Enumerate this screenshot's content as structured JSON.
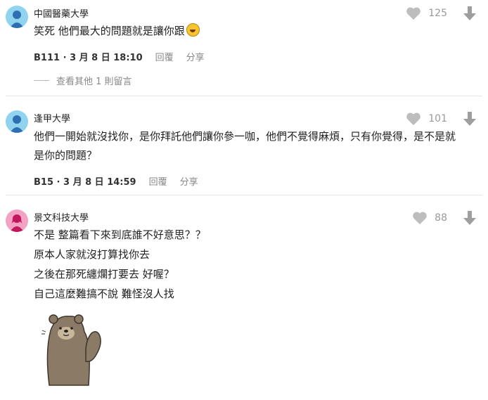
{
  "comments": [
    {
      "school": "中國醫藥大學",
      "lines": [
        "笑死 他們最大的問題就是讓你跟"
      ],
      "floor": "B111",
      "time": "3 月 8 日 18:10",
      "reply_label": "回覆",
      "share_label": "分享",
      "likes": "125",
      "more_replies": "查看其他 1 則留言",
      "avatar_color": "#8fd3ee"
    },
    {
      "school": "逢甲大學",
      "lines": [
        "他們一開始就沒找你，是你拜託他們讓你參一咖，他們不覺得麻煩，只有你覺得，是不是就",
        "是你的問題？"
      ],
      "floor": "B15",
      "time": "3 月 8 日 14:59",
      "reply_label": "回覆",
      "share_label": "分享",
      "likes": "101",
      "avatar_color": "#8fd3ee"
    },
    {
      "school": "景文科技大學",
      "lines": [
        "不是 整篇看下來到底誰不好意思？？",
        "原本人家就沒打算找你去",
        "之後在那死纏爛打要去 好喔？",
        "自己這麼難搞不說 難怪沒人找"
      ],
      "likes": "88",
      "avatar_color": "#f2a2c2",
      "sticker": "bear-sticker"
    }
  ],
  "meta_separator": "·",
  "icons": {
    "like": "heart-icon",
    "dislike": "arrow-down-icon",
    "emoji": "laughing-emoji-icon"
  }
}
